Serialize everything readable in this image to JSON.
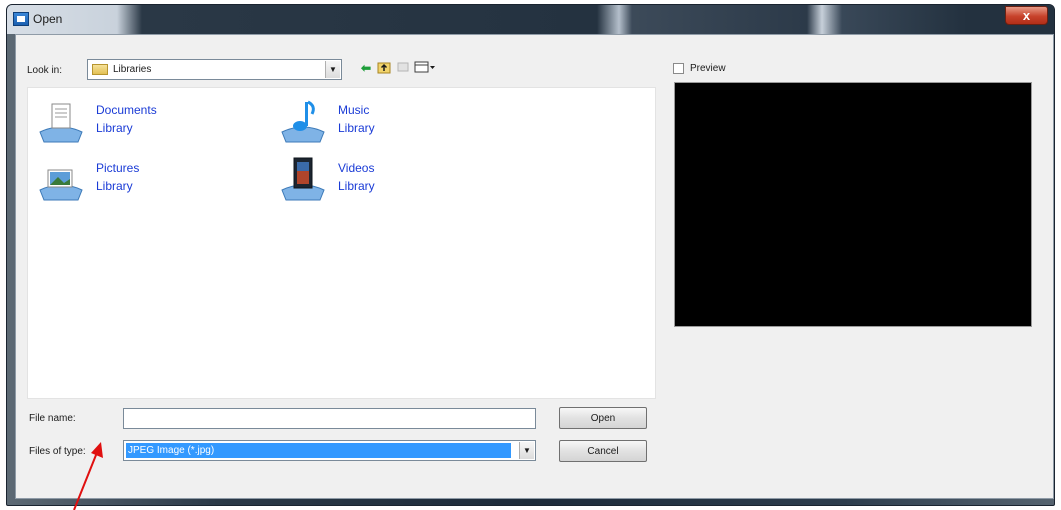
{
  "window": {
    "title": "Open",
    "close_label": "x"
  },
  "lookin": {
    "label": "Look in:",
    "value": "Libraries"
  },
  "toolbar": {
    "icons": [
      "back-icon",
      "up-folder-icon",
      "new-folder-icon",
      "view-menu-icon"
    ]
  },
  "libraries": [
    {
      "name": "Documents",
      "sub": "Library",
      "icon": "documents-library-icon"
    },
    {
      "name": "Music",
      "sub": "Library",
      "icon": "music-library-icon"
    },
    {
      "name": "Pictures",
      "sub": "Library",
      "icon": "pictures-library-icon"
    },
    {
      "name": "Videos",
      "sub": "Library",
      "icon": "videos-library-icon"
    }
  ],
  "filename": {
    "label": "File name:",
    "value": ""
  },
  "filetype": {
    "label": "Files of type:",
    "value": "JPEG Image (*.jpg)"
  },
  "buttons": {
    "open": "Open",
    "cancel": "Cancel"
  },
  "preview": {
    "label": "Preview",
    "checked": false
  },
  "colors": {
    "link_text": "#1a3bd6",
    "selection": "#3399ff",
    "preview_bg": "#000000",
    "annotation": "#e01010"
  }
}
